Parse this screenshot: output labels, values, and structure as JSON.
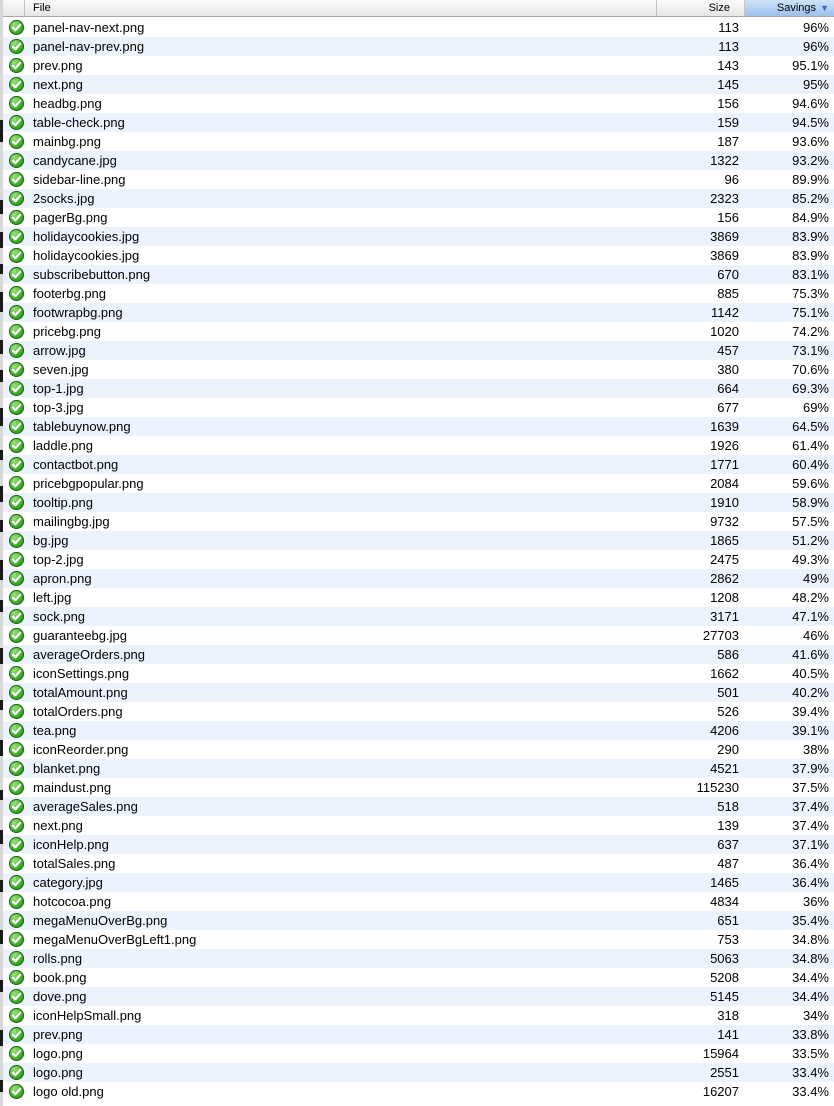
{
  "header": {
    "file": "File",
    "size": "Size",
    "savings": "Savings",
    "sort_arrow": "▼"
  },
  "icon": {
    "name": "check-circle-icon",
    "color": "#3fae2a"
  },
  "rows": [
    {
      "file": "panel-nav-next.png",
      "size": "113",
      "savings": "96%"
    },
    {
      "file": "panel-nav-prev.png",
      "size": "113",
      "savings": "96%"
    },
    {
      "file": "prev.png",
      "size": "143",
      "savings": "95.1%"
    },
    {
      "file": "next.png",
      "size": "145",
      "savings": "95%"
    },
    {
      "file": "headbg.png",
      "size": "156",
      "savings": "94.6%"
    },
    {
      "file": "table-check.png",
      "size": "159",
      "savings": "94.5%"
    },
    {
      "file": "mainbg.png",
      "size": "187",
      "savings": "93.6%"
    },
    {
      "file": "candycane.jpg",
      "size": "1322",
      "savings": "93.2%"
    },
    {
      "file": "sidebar-line.png",
      "size": "96",
      "savings": "89.9%"
    },
    {
      "file": "2socks.jpg",
      "size": "2323",
      "savings": "85.2%"
    },
    {
      "file": "pagerBg.png",
      "size": "156",
      "savings": "84.9%"
    },
    {
      "file": "holidaycookies.jpg",
      "size": "3869",
      "savings": "83.9%"
    },
    {
      "file": "holidaycookies.jpg",
      "size": "3869",
      "savings": "83.9%"
    },
    {
      "file": "subscribebutton.png",
      "size": "670",
      "savings": "83.1%"
    },
    {
      "file": "footerbg.png",
      "size": "885",
      "savings": "75.3%"
    },
    {
      "file": "footwrapbg.png",
      "size": "1142",
      "savings": "75.1%"
    },
    {
      "file": "pricebg.png",
      "size": "1020",
      "savings": "74.2%"
    },
    {
      "file": "arrow.jpg",
      "size": "457",
      "savings": "73.1%"
    },
    {
      "file": "seven.jpg",
      "size": "380",
      "savings": "70.6%"
    },
    {
      "file": "top-1.jpg",
      "size": "664",
      "savings": "69.3%"
    },
    {
      "file": "top-3.jpg",
      "size": "677",
      "savings": "69%"
    },
    {
      "file": "tablebuynow.png",
      "size": "1639",
      "savings": "64.5%"
    },
    {
      "file": "laddle.png",
      "size": "1926",
      "savings": "61.4%"
    },
    {
      "file": "contactbot.png",
      "size": "1771",
      "savings": "60.4%"
    },
    {
      "file": "pricebgpopular.png",
      "size": "2084",
      "savings": "59.6%"
    },
    {
      "file": "tooltip.png",
      "size": "1910",
      "savings": "58.9%"
    },
    {
      "file": "mailingbg.jpg",
      "size": "9732",
      "savings": "57.5%"
    },
    {
      "file": "bg.jpg",
      "size": "1865",
      "savings": "51.2%"
    },
    {
      "file": "top-2.jpg",
      "size": "2475",
      "savings": "49.3%"
    },
    {
      "file": "apron.png",
      "size": "2862",
      "savings": "49%"
    },
    {
      "file": "left.jpg",
      "size": "1208",
      "savings": "48.2%"
    },
    {
      "file": "sock.png",
      "size": "3171",
      "savings": "47.1%"
    },
    {
      "file": "guaranteebg.jpg",
      "size": "27703",
      "savings": "46%"
    },
    {
      "file": "averageOrders.png",
      "size": "586",
      "savings": "41.6%"
    },
    {
      "file": "iconSettings.png",
      "size": "1662",
      "savings": "40.5%"
    },
    {
      "file": "totalAmount.png",
      "size": "501",
      "savings": "40.2%"
    },
    {
      "file": "totalOrders.png",
      "size": "526",
      "savings": "39.4%"
    },
    {
      "file": "tea.png",
      "size": "4206",
      "savings": "39.1%"
    },
    {
      "file": "iconReorder.png",
      "size": "290",
      "savings": "38%"
    },
    {
      "file": "blanket.png",
      "size": "4521",
      "savings": "37.9%"
    },
    {
      "file": "maindust.png",
      "size": "115230",
      "savings": "37.5%"
    },
    {
      "file": "averageSales.png",
      "size": "518",
      "savings": "37.4%"
    },
    {
      "file": "next.png",
      "size": "139",
      "savings": "37.4%"
    },
    {
      "file": "iconHelp.png",
      "size": "637",
      "savings": "37.1%"
    },
    {
      "file": "totalSales.png",
      "size": "487",
      "savings": "36.4%"
    },
    {
      "file": "category.jpg",
      "size": "1465",
      "savings": "36.4%"
    },
    {
      "file": "hotcocoa.png",
      "size": "4834",
      "savings": "36%"
    },
    {
      "file": "megaMenuOverBg.png",
      "size": "651",
      "savings": "35.4%"
    },
    {
      "file": "megaMenuOverBgLeft1.png",
      "size": "753",
      "savings": "34.8%"
    },
    {
      "file": "rolls.png",
      "size": "5063",
      "savings": "34.8%"
    },
    {
      "file": "book.png",
      "size": "5208",
      "savings": "34.4%"
    },
    {
      "file": "dove.png",
      "size": "5145",
      "savings": "34.4%"
    },
    {
      "file": "iconHelpSmall.png",
      "size": "318",
      "savings": "34%"
    },
    {
      "file": "prev.png",
      "size": "141",
      "savings": "33.8%"
    },
    {
      "file": "logo.png",
      "size": "15964",
      "savings": "33.5%"
    },
    {
      "file": "logo.png",
      "size": "2551",
      "savings": "33.4%"
    },
    {
      "file": "logo old.png",
      "size": "16207",
      "savings": "33.4%"
    }
  ]
}
